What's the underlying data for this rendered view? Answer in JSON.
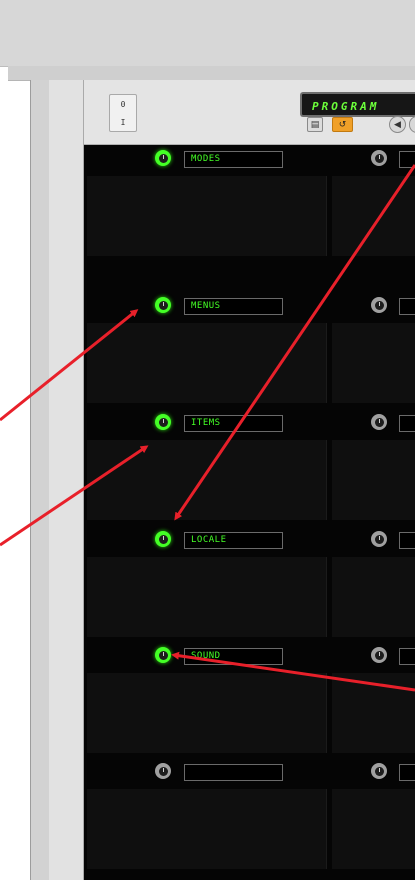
{
  "device": {
    "lcd_text": "PROGRAM",
    "io_switch": {
      "on": "0",
      "off": "I"
    },
    "buttons": {
      "copy": "▤",
      "undo": "↺",
      "prev": "◀"
    }
  },
  "slots": [
    {
      "label": "MODES",
      "active": true
    },
    {
      "label": "MENUS",
      "active": true
    },
    {
      "label": "ITEMS",
      "active": true
    },
    {
      "label": "LOCALE",
      "active": true
    },
    {
      "label": "SOUND",
      "active": true
    },
    {
      "label": "",
      "active": false
    }
  ],
  "colors": {
    "lcd_text": "#6cff3a",
    "active_knob": "#44ff26",
    "annotation_arrow": "#e8202a",
    "undo_button": "#f0a028"
  }
}
